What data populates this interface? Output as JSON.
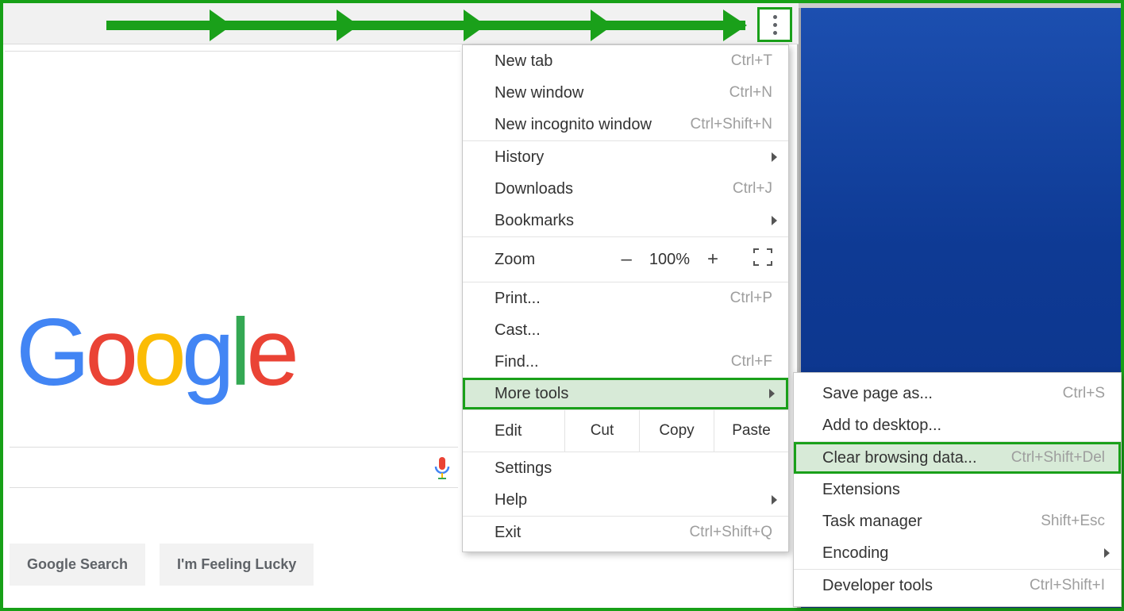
{
  "logo_letters": "Google",
  "search_placeholder": "",
  "home_buttons": {
    "search": "Google Search",
    "lucky": "I'm Feeling Lucky"
  },
  "menu_button_name": "Customize and control Google Chrome",
  "main_menu": {
    "new_tab": {
      "label": "New tab",
      "shortcut": "Ctrl+T"
    },
    "new_window": {
      "label": "New window",
      "shortcut": "Ctrl+N"
    },
    "new_incognito": {
      "label": "New incognito window",
      "shortcut": "Ctrl+Shift+N"
    },
    "history": {
      "label": "History"
    },
    "downloads": {
      "label": "Downloads",
      "shortcut": "Ctrl+J"
    },
    "bookmarks": {
      "label": "Bookmarks"
    },
    "zoom": {
      "label": "Zoom",
      "value": "100%",
      "minus": "–",
      "plus": "+"
    },
    "print": {
      "label": "Print...",
      "shortcut": "Ctrl+P"
    },
    "cast": {
      "label": "Cast..."
    },
    "find": {
      "label": "Find...",
      "shortcut": "Ctrl+F"
    },
    "more_tools": {
      "label": "More tools"
    },
    "edit": {
      "label": "Edit",
      "cut": "Cut",
      "copy": "Copy",
      "paste": "Paste"
    },
    "settings": {
      "label": "Settings"
    },
    "help": {
      "label": "Help"
    },
    "exit": {
      "label": "Exit",
      "shortcut": "Ctrl+Shift+Q"
    }
  },
  "sub_menu": {
    "save_page": {
      "label": "Save page as...",
      "shortcut": "Ctrl+S"
    },
    "add_desktop": {
      "label": "Add to desktop..."
    },
    "clear_data": {
      "label": "Clear browsing data...",
      "shortcut": "Ctrl+Shift+Del"
    },
    "extensions": {
      "label": "Extensions"
    },
    "task_mgr": {
      "label": "Task manager",
      "shortcut": "Shift+Esc"
    },
    "encoding": {
      "label": "Encoding"
    },
    "dev_tools": {
      "label": "Developer tools",
      "shortcut": "Ctrl+Shift+I"
    }
  },
  "annotation": {
    "highlight_main": "more_tools",
    "highlight_sub": "clear_data"
  }
}
